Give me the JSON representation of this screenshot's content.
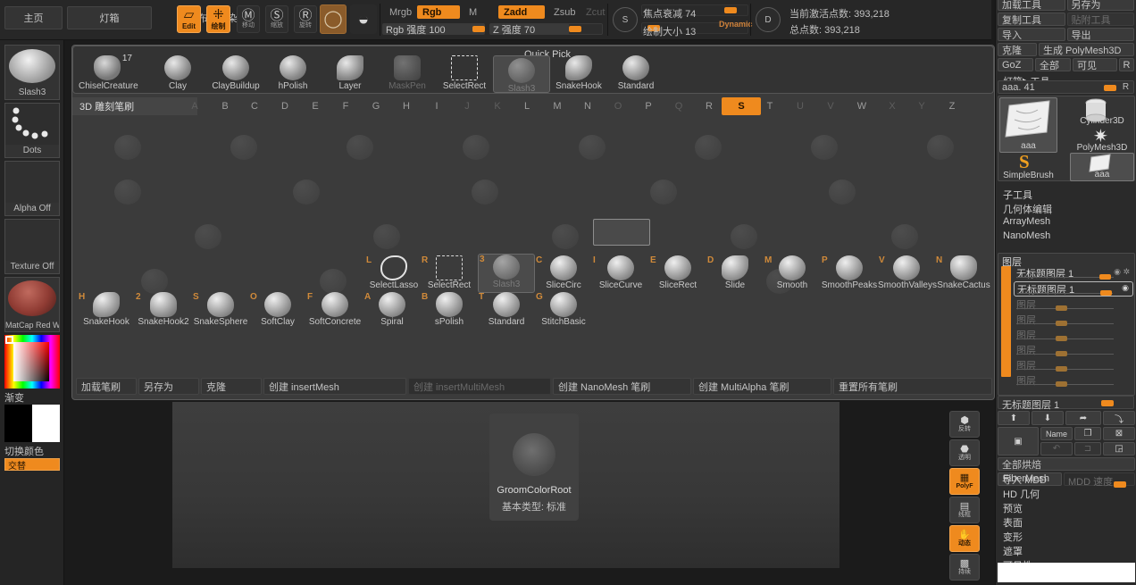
{
  "topbar": {
    "nav": [
      {
        "label": "主页"
      },
      {
        "label": "灯箱"
      },
      {
        "label": "预览布尔渲染"
      }
    ],
    "mode_buttons": [
      {
        "label": "Edit",
        "glyph": "▱",
        "state": "on"
      },
      {
        "label": "绘制",
        "glyph": "⁜",
        "state": "on"
      }
    ],
    "icon_buttons": [
      {
        "label": "移动",
        "glyph": "M",
        "state": "off"
      },
      {
        "label": "缩放",
        "glyph": "S",
        "state": "off"
      },
      {
        "label": "旋转",
        "glyph": "R",
        "state": "off"
      },
      {
        "label": "材质球",
        "glyph": "◯",
        "state": "brown"
      },
      {
        "label": "材质",
        "glyph": "◓",
        "state": "off"
      }
    ],
    "color_modes": [
      {
        "label": "Mrgb",
        "state": "off"
      },
      {
        "label": "Rgb",
        "state": "on"
      },
      {
        "label": "M",
        "state": "off"
      }
    ],
    "z_modes": [
      {
        "label": "Zadd",
        "state": "on"
      },
      {
        "label": "Zsub",
        "state": "off"
      },
      {
        "label": "Zcut",
        "state": "disabled"
      }
    ],
    "sliders": [
      {
        "label": "Rgb 强度",
        "value": "100",
        "pct": 100
      },
      {
        "label": "Z 强度",
        "value": "70",
        "pct": 70
      },
      {
        "label": "焦点衰减",
        "value": "74",
        "pct": 88
      },
      {
        "label": "绘制大小",
        "value": "13",
        "pct": 10
      }
    ],
    "dynamic_label": "Dynamic",
    "stock_icons": [
      {
        "letter": "S",
        "name": "stroke-icon"
      },
      {
        "letter": "D",
        "name": "draw-icon"
      }
    ],
    "stats": [
      {
        "label": "当前激活点数:",
        "value": "393,218"
      },
      {
        "label": "总点数:",
        "value": "393,218"
      }
    ]
  },
  "left_shelf": {
    "cells": [
      {
        "label": "Slash3",
        "kind": "brush",
        "name": "current-brush"
      },
      {
        "label": "Dots",
        "kind": "stroke",
        "name": "current-stroke"
      },
      {
        "label": "Alpha Off",
        "kind": "empty",
        "name": "current-alpha"
      },
      {
        "label": "Texture Off",
        "kind": "empty",
        "name": "current-texture"
      },
      {
        "label": "MatCap Red Wa",
        "kind": "material",
        "name": "current-material"
      }
    ],
    "gradient_label": "渐变",
    "switch_color_label": "切换颜色",
    "alt_label": "交替",
    "primary_color": "#000000",
    "secondary_color": "#ffffff"
  },
  "quick_pick": {
    "title": "Quick Pick",
    "count_badge": "17",
    "items": [
      {
        "label": "ChiselCreature",
        "state": "normal"
      },
      {
        "label": "Clay",
        "state": "normal"
      },
      {
        "label": "ClayBuildup",
        "state": "normal"
      },
      {
        "label": "hPolish",
        "state": "normal"
      },
      {
        "label": "Layer",
        "state": "normal"
      },
      {
        "label": "MaskPen",
        "state": "dimmed"
      },
      {
        "label": "SelectRect",
        "state": "square"
      },
      {
        "label": "Slash3",
        "state": "selected"
      },
      {
        "label": "SnakeHook",
        "state": "normal"
      },
      {
        "label": "Standard",
        "state": "normal"
      }
    ]
  },
  "brush_palette": {
    "header": "3D 雕刻笔刷",
    "letters": [
      {
        "l": "A",
        "state": "off"
      },
      {
        "l": "B",
        "state": "on-off"
      },
      {
        "l": "C",
        "state": "on-off"
      },
      {
        "l": "D",
        "state": "on-off"
      },
      {
        "l": "E",
        "state": "on-off"
      },
      {
        "l": "F",
        "state": "on-off"
      },
      {
        "l": "G",
        "state": "on-off"
      },
      {
        "l": "H",
        "state": "on-off"
      },
      {
        "l": "I",
        "state": "on-off"
      },
      {
        "l": "J",
        "state": "off"
      },
      {
        "l": "K",
        "state": "off"
      },
      {
        "l": "L",
        "state": "on-off"
      },
      {
        "l": "M",
        "state": "on-off"
      },
      {
        "l": "N",
        "state": "on-off"
      },
      {
        "l": "O",
        "state": "off"
      },
      {
        "l": "P",
        "state": "on-off"
      },
      {
        "l": "Q",
        "state": "off"
      },
      {
        "l": "R",
        "state": "on-off"
      },
      {
        "l": "S",
        "state": "active"
      },
      {
        "l": "T",
        "state": "on-off"
      },
      {
        "l": "U",
        "state": "off"
      },
      {
        "l": "V",
        "state": "off"
      },
      {
        "l": "W",
        "state": "on-off"
      },
      {
        "l": "X",
        "state": "off"
      },
      {
        "l": "Y",
        "state": "off"
      },
      {
        "l": "Z",
        "state": "on-off"
      }
    ],
    "row1": [
      {
        "key": "L",
        "label": "SelectLasso",
        "style": "lasso"
      },
      {
        "key": "R",
        "label": "SelectRect",
        "style": "square"
      },
      {
        "key": "3",
        "label": "Slash3",
        "style": "selected"
      },
      {
        "key": "C",
        "label": "SliceCirc",
        "style": "normal"
      },
      {
        "key": "I",
        "label": "SliceCurve",
        "style": "normal"
      },
      {
        "key": "E",
        "label": "SliceRect",
        "style": "normal"
      },
      {
        "key": "D",
        "label": "Slide",
        "style": "normal"
      },
      {
        "key": "M",
        "label": "Smooth",
        "style": "normal"
      },
      {
        "key": "P",
        "label": "SmoothPeaks",
        "style": "normal"
      },
      {
        "key": "V",
        "label": "SmoothValleys",
        "style": "normal"
      },
      {
        "key": "N",
        "label": "SnakeCactus",
        "style": "normal"
      }
    ],
    "row2": [
      {
        "key": "H",
        "label": "SnakeHook",
        "style": "normal"
      },
      {
        "key": "2",
        "label": "SnakeHook2",
        "style": "normal"
      },
      {
        "key": "S",
        "label": "SnakeSphere",
        "style": "normal"
      },
      {
        "key": "O",
        "label": "SoftClay",
        "style": "normal"
      },
      {
        "key": "F",
        "label": "SoftConcrete",
        "style": "normal"
      },
      {
        "key": "A",
        "label": "Spiral",
        "style": "normal"
      },
      {
        "key": "B",
        "label": "sPolish",
        "style": "normal"
      },
      {
        "key": "T",
        "label": "Standard",
        "style": "normal"
      },
      {
        "key": "G",
        "label": "StitchBasic",
        "style": "normal"
      }
    ],
    "bottom_buttons": [
      {
        "label": "加载笔刷",
        "state": "normal",
        "w": 70
      },
      {
        "label": "另存为",
        "state": "normal",
        "w": 70
      },
      {
        "label": "克隆",
        "state": "normal",
        "w": 70
      },
      {
        "label": "创建 insertMesh",
        "state": "normal",
        "w": 162
      },
      {
        "label": "创建 insertMultiMesh",
        "state": "dim",
        "w": 162
      },
      {
        "label": "创建 NanoMesh 笔刷",
        "state": "normal",
        "w": 160
      },
      {
        "label": "创建 MultiAlpha 笔刷",
        "state": "normal",
        "w": 160
      },
      {
        "label": "重置所有笔刷",
        "state": "normal",
        "w": 190
      }
    ]
  },
  "canvas": {
    "card": {
      "title": "GroomColorRoot",
      "subtitle": "基本类型: 标准"
    }
  },
  "vstrip": [
    {
      "glyph": "⬢",
      "label": "反转",
      "state": "off",
      "name": "vstrip-invert"
    },
    {
      "glyph": "⬣",
      "label": "透明",
      "state": "off",
      "name": "vstrip-transp"
    },
    {
      "glyph": "▦",
      "label": "PolyF",
      "state": "on",
      "name": "vstrip-polyframe"
    },
    {
      "glyph": "▤",
      "label": "线框",
      "state": "off",
      "name": "vstrip-wireframe"
    },
    {
      "glyph": "✋",
      "label": "动态",
      "state": "on",
      "name": "vstrip-dynamic"
    },
    {
      "glyph": "▩",
      "label": "持续",
      "state": "off",
      "name": "vstrip-persp"
    }
  ],
  "right_panel": {
    "tool_rows": [
      [
        {
          "label": "加载工具",
          "state": "normal"
        },
        {
          "label": "另存为",
          "state": "normal"
        }
      ],
      [
        {
          "label": "复制工具",
          "state": "normal"
        },
        {
          "label": "贴附工具",
          "state": "dim"
        }
      ],
      [
        {
          "label": "导入",
          "state": "normal"
        },
        {
          "label": "导出",
          "state": "normal"
        }
      ],
      [
        {
          "label": "克隆",
          "state": "normal"
        },
        {
          "label": "生成 PolyMesh3D",
          "state": "normal"
        }
      ],
      [
        {
          "label": "GoZ",
          "state": "normal"
        },
        {
          "label": "全部",
          "state": "normal"
        },
        {
          "label": "可见",
          "state": "normal"
        },
        {
          "label": "R",
          "state": "normal"
        }
      ]
    ],
    "tool_menu_label": "灯箱▶工具",
    "tool_slider": {
      "label": "aaa. 41",
      "right_letter": "R",
      "pct": 82
    },
    "tool_cells": [
      {
        "label": "aaa",
        "state": "selected",
        "shape": "plane"
      },
      {
        "label": "Cylinder3D",
        "state": "normal",
        "shape": "cylinder"
      },
      {
        "label": "PolyMesh3D",
        "state": "normal",
        "shape": "star"
      },
      {
        "label": "SimpleBrush",
        "state": "normal",
        "shape": "s"
      },
      {
        "label": "aaa",
        "state": "selected2",
        "shape": "plane"
      }
    ],
    "sections": [
      "子工具",
      "几何体编辑",
      "ArrayMesh",
      "NanoMesh"
    ],
    "layers": {
      "header": "图层",
      "rows": [
        {
          "label": "无标题图层 1",
          "state": "active",
          "knob": 72,
          "eyes": true
        },
        {
          "label": "无标题图层 1",
          "state": "selected",
          "knob": 72,
          "rec": true
        },
        {
          "label": "图层",
          "state": "dim",
          "knob": 35
        },
        {
          "label": "图层",
          "state": "dim",
          "knob": 35
        },
        {
          "label": "图层",
          "state": "dim",
          "knob": 35
        },
        {
          "label": "图层",
          "state": "dim",
          "knob": 35
        },
        {
          "label": "图层",
          "state": "dim",
          "knob": 35
        },
        {
          "label": "图层",
          "state": "dim",
          "knob": 35
        }
      ],
      "footer_slider": {
        "label": "无标题图层 1",
        "pct": 80
      }
    },
    "layer_tool_row1": [
      {
        "glyph": "⬆",
        "name": "layer-up-button",
        "state": "normal"
      },
      {
        "glyph": "⬇",
        "name": "layer-down-button",
        "state": "normal"
      },
      {
        "glyph": "➦",
        "name": "layer-merge-button",
        "state": "normal"
      },
      {
        "glyph": "⤵",
        "name": "layer-split-button",
        "state": "normal"
      }
    ],
    "layer_tool_row2": [
      {
        "glyph": "▣",
        "name": "layer-grid-button",
        "state": "normal"
      },
      {
        "label": "Name",
        "name": "layer-rename-button",
        "state": "normal"
      },
      {
        "glyph": "❐",
        "name": "layer-duplicate-button",
        "state": "normal"
      },
      {
        "glyph": "⊠",
        "name": "layer-delete-button",
        "state": "normal"
      }
    ],
    "layer_tool_row3": [
      {
        "glyph": "↶",
        "name": "layer-undo-button",
        "state": "dim"
      },
      {
        "glyph": "⊐",
        "name": "layer-import-button",
        "state": "dim"
      },
      {
        "glyph": "◲",
        "name": "layer-export-button",
        "state": "normal"
      }
    ],
    "bake_all_label": "全部烘焙",
    "mdd_import_label": "导入 MDD",
    "mdd_speed_label": "MDD 速度",
    "bottom_sections": [
      "FiberMesh",
      "HD 几何",
      "预览",
      "表面",
      "变形",
      "遮罩",
      "可见性"
    ]
  }
}
